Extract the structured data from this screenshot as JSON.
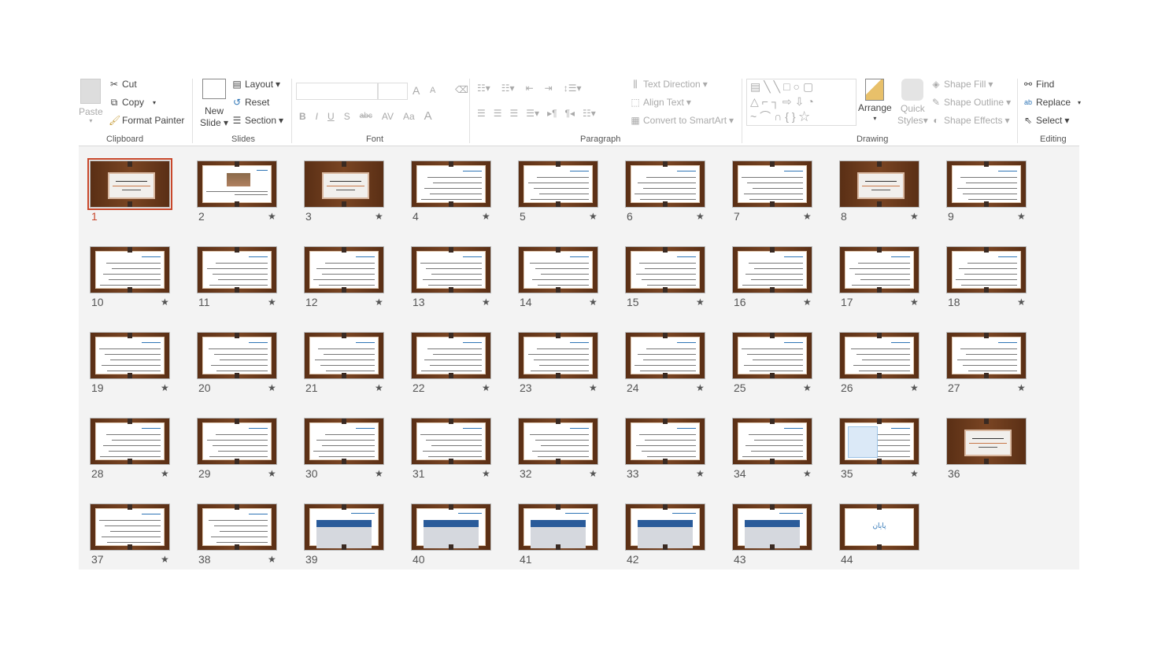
{
  "ribbon": {
    "clipboard": {
      "paste": "Paste",
      "cut": "Cut",
      "copy": "Copy",
      "format_painter": "Format Painter",
      "label": "Clipboard"
    },
    "slides": {
      "new_slide_1": "New",
      "new_slide_2": "Slide",
      "layout": "Layout",
      "reset": "Reset",
      "section": "Section",
      "label": "Slides"
    },
    "font": {
      "bold": "B",
      "italic": "I",
      "underline": "U",
      "shadow": "S",
      "strike": "abc",
      "spacing": "AV",
      "case": "Aa",
      "color": "A",
      "grow": "A",
      "shrink": "A",
      "label": "Font"
    },
    "paragraph": {
      "text_direction": "Text Direction",
      "align_text": "Align Text",
      "convert_smartart": "Convert to SmartArt",
      "label": "Paragraph"
    },
    "drawing": {
      "arrange": "Arrange",
      "quick_styles_1": "Quick",
      "quick_styles_2": "Styles",
      "shape_fill": "Shape Fill",
      "shape_outline": "Shape Outline",
      "shape_effects": "Shape Effects",
      "label": "Drawing"
    },
    "editing": {
      "find": "Find",
      "replace": "Replace",
      "select": "Select",
      "label": "Editing"
    }
  },
  "colors": {
    "selected": "#c8472b",
    "wood": "#6b3a1c",
    "table_header": "#2a5b9a"
  },
  "slides": [
    {
      "n": "1",
      "type": "title",
      "star": false,
      "selected": true
    },
    {
      "n": "2",
      "type": "image",
      "star": true
    },
    {
      "n": "3",
      "type": "title",
      "star": true
    },
    {
      "n": "4",
      "type": "text",
      "star": true
    },
    {
      "n": "5",
      "type": "text",
      "star": true
    },
    {
      "n": "6",
      "type": "text",
      "star": true
    },
    {
      "n": "7",
      "type": "text",
      "star": true
    },
    {
      "n": "8",
      "type": "title",
      "star": true
    },
    {
      "n": "9",
      "type": "text",
      "star": true
    },
    {
      "n": "10",
      "type": "text",
      "star": true
    },
    {
      "n": "11",
      "type": "text",
      "star": true
    },
    {
      "n": "12",
      "type": "text",
      "star": true
    },
    {
      "n": "13",
      "type": "text",
      "star": true
    },
    {
      "n": "14",
      "type": "text",
      "star": true
    },
    {
      "n": "15",
      "type": "text",
      "star": true
    },
    {
      "n": "16",
      "type": "text",
      "star": true
    },
    {
      "n": "17",
      "type": "text",
      "star": true
    },
    {
      "n": "18",
      "type": "text",
      "star": true
    },
    {
      "n": "19",
      "type": "text",
      "star": true
    },
    {
      "n": "20",
      "type": "text",
      "star": true
    },
    {
      "n": "21",
      "type": "text",
      "star": true
    },
    {
      "n": "22",
      "type": "text",
      "star": true
    },
    {
      "n": "23",
      "type": "text",
      "star": true
    },
    {
      "n": "24",
      "type": "text",
      "star": true
    },
    {
      "n": "25",
      "type": "text",
      "star": true
    },
    {
      "n": "26",
      "type": "text",
      "star": true
    },
    {
      "n": "27",
      "type": "text",
      "star": true
    },
    {
      "n": "28",
      "type": "text",
      "star": true
    },
    {
      "n": "29",
      "type": "text",
      "star": true
    },
    {
      "n": "30",
      "type": "text",
      "star": true
    },
    {
      "n": "31",
      "type": "text",
      "star": true
    },
    {
      "n": "32",
      "type": "text",
      "star": true
    },
    {
      "n": "33",
      "type": "text",
      "star": true
    },
    {
      "n": "34",
      "type": "text",
      "star": true
    },
    {
      "n": "35",
      "type": "diagram",
      "star": true
    },
    {
      "n": "36",
      "type": "title",
      "star": false
    },
    {
      "n": "37",
      "type": "text",
      "star": true
    },
    {
      "n": "38",
      "type": "text",
      "star": true
    },
    {
      "n": "39",
      "type": "table",
      "star": false
    },
    {
      "n": "40",
      "type": "table",
      "star": false
    },
    {
      "n": "41",
      "type": "table",
      "star": false
    },
    {
      "n": "42",
      "type": "table",
      "star": false
    },
    {
      "n": "43",
      "type": "table",
      "star": false
    },
    {
      "n": "44",
      "type": "end",
      "star": false,
      "text": "پایان"
    }
  ],
  "star_glyph": "★"
}
